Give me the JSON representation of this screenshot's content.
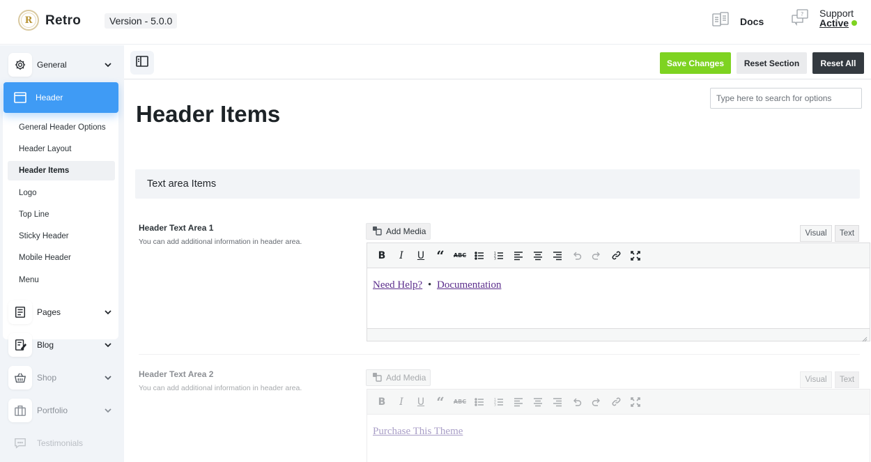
{
  "topbar": {
    "brand": "Retro",
    "logo_letter": "R",
    "version": "Version - 5.0.0",
    "docs_label": "Docs",
    "support_label": "Support",
    "support_status": "Active",
    "support_status_color": "#7ed321"
  },
  "sidebar": {
    "general": {
      "label": "General",
      "icon": "gear-icon"
    },
    "header": {
      "label": "Header",
      "icon": "layout-icon",
      "subitems": [
        "General Header Options",
        "Header Layout",
        "Header Items",
        "Logo",
        "Top Line",
        "Sticky Header",
        "Mobile Header",
        "Menu"
      ],
      "active_subitem": "Header Items"
    },
    "pages": {
      "label": "Pages",
      "icon": "pages-icon"
    },
    "blog": {
      "label": "Blog",
      "icon": "blog-icon"
    },
    "shop": {
      "label": "Shop",
      "icon": "basket-icon"
    },
    "portfolio": {
      "label": "Portfolio",
      "icon": "briefcase-icon"
    },
    "testimonials": {
      "label": "Testimonials",
      "icon": "chat-icon"
    }
  },
  "toolbar": {
    "save_label": "Save Changes",
    "reset_section_label": "Reset Section",
    "reset_all_label": "Reset All",
    "save_color": "#7ed321"
  },
  "search": {
    "placeholder": "Type here to search for options"
  },
  "page": {
    "title": "Header Items"
  },
  "section": {
    "title": "Text area Items"
  },
  "fields": [
    {
      "title": "Header Text Area 1",
      "description": "You can add additional information in header area.",
      "add_media_label": "Add Media",
      "tab_visual": "Visual",
      "tab_text": "Text",
      "content": {
        "link1": "Need Help?",
        "separator": "•",
        "link2": "Documentation"
      }
    },
    {
      "title": "Header Text Area 2",
      "description": "You can add additional information in header area.",
      "add_media_label": "Add Media",
      "tab_visual": "Visual",
      "tab_text": "Text",
      "content": {
        "link1": "Purchase This Theme"
      }
    }
  ]
}
